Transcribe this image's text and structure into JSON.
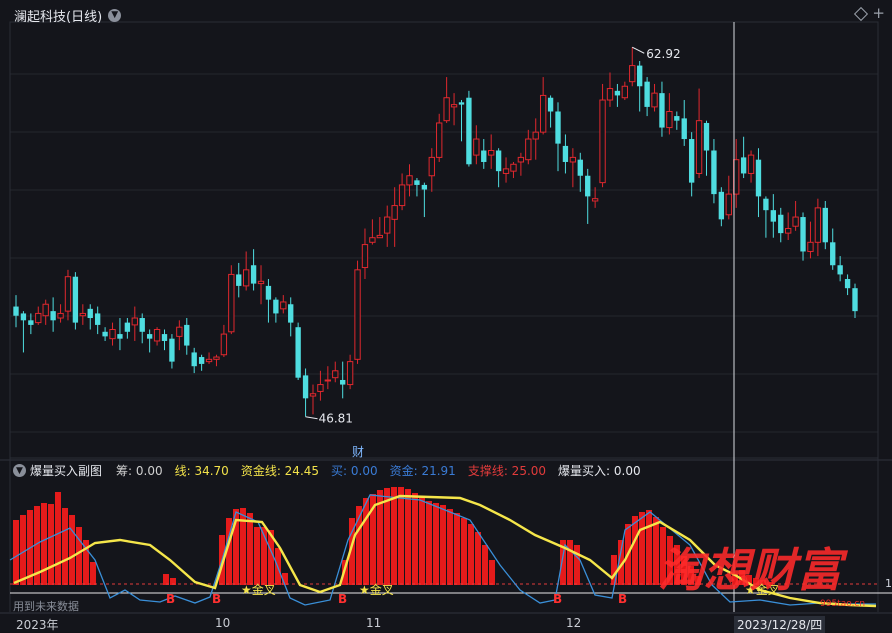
{
  "header": {
    "title": "澜起科技(日线)",
    "menu_icon": "chevron-down-icon",
    "right_icons": [
      "diamond-icon",
      "plus-icon"
    ]
  },
  "main_chart": {
    "labels": {
      "high": "62.92",
      "low": "46.81",
      "marker": "财"
    }
  },
  "sub_panel": {
    "title": "爆量买入副图",
    "indicators": [
      {
        "label": "筹",
        "value": "0.00",
        "color": "#d0d0d0"
      },
      {
        "label": "线",
        "value": "34.70",
        "color": "#f2e24a"
      },
      {
        "label": "资金线",
        "value": "24.45",
        "color": "#f2e24a"
      },
      {
        "label": "买",
        "value": "0.00",
        "color": "#3a7bd5"
      },
      {
        "label": "资金",
        "value": "21.91",
        "color": "#3a7bd5"
      },
      {
        "label": "支撑线",
        "value": "25.00",
        "color": "#e23b3b"
      },
      {
        "label": "爆量买入",
        "value": "0.00",
        "color": "#e6e8ee"
      }
    ],
    "signals": {
      "buy": "B",
      "golden_cross": "金叉"
    },
    "footer_note": "用到未来数据",
    "axis_right": "1"
  },
  "x_axis": {
    "labels": [
      "2023年",
      "10",
      "11",
      "12",
      "2023/12/28/四"
    ]
  },
  "watermark": {
    "text": "淘想财富",
    "site": "995tao.cn"
  },
  "colors": {
    "up": "#e0282e",
    "down": "#4fdde0",
    "line_yellow": "#f5e64a",
    "line_blue": "#3a8fd8",
    "support": "#e23b3b",
    "bg": "#14151b"
  },
  "chart_data": {
    "type": "candlestick",
    "ylim": [
      45,
      64
    ],
    "candles": [
      [
        51.2,
        51.6,
        52.1,
        50.7,
        0
      ],
      [
        51.3,
        51.0,
        51.4,
        49.6,
        0
      ],
      [
        51.0,
        50.8,
        51.3,
        50.4,
        0
      ],
      [
        50.9,
        51.3,
        51.6,
        50.8,
        1
      ],
      [
        51.2,
        51.7,
        51.9,
        50.8,
        1
      ],
      [
        51.4,
        51.0,
        52.0,
        50.5,
        0
      ],
      [
        51.1,
        51.3,
        51.7,
        50.9,
        1
      ],
      [
        51.4,
        52.9,
        53.2,
        51.0,
        1
      ],
      [
        52.9,
        50.9,
        53.1,
        50.6,
        0
      ],
      [
        51.2,
        51.3,
        51.7,
        50.8,
        1
      ],
      [
        51.5,
        51.1,
        51.7,
        50.6,
        0
      ],
      [
        51.3,
        50.8,
        51.6,
        50.4,
        0
      ],
      [
        50.5,
        50.3,
        50.7,
        50.1,
        0
      ],
      [
        50.2,
        50.6,
        50.9,
        49.9,
        1
      ],
      [
        50.4,
        50.2,
        51.1,
        49.7,
        0
      ],
      [
        50.9,
        50.5,
        51.1,
        50.2,
        0
      ],
      [
        50.8,
        51.1,
        51.6,
        50.1,
        1
      ],
      [
        51.1,
        50.5,
        51.3,
        50.0,
        0
      ],
      [
        50.4,
        50.2,
        50.6,
        49.6,
        0
      ],
      [
        50.1,
        50.6,
        50.7,
        49.9,
        1
      ],
      [
        50.4,
        50.1,
        50.6,
        49.7,
        0
      ],
      [
        50.2,
        49.2,
        50.4,
        48.9,
        0
      ],
      [
        50.3,
        50.7,
        51.0,
        49.7,
        1
      ],
      [
        50.8,
        49.9,
        51.1,
        49.5,
        0
      ],
      [
        49.6,
        49.0,
        49.8,
        48.7,
        0
      ],
      [
        49.4,
        49.1,
        49.5,
        48.8,
        0
      ],
      [
        49.2,
        49.3,
        49.6,
        49.1,
        1
      ],
      [
        49.3,
        49.4,
        49.5,
        49.0,
        1
      ],
      [
        49.5,
        50.4,
        50.8,
        49.4,
        1
      ],
      [
        50.5,
        53.0,
        53.4,
        50.4,
        1
      ],
      [
        53.0,
        52.5,
        53.5,
        52.0,
        0
      ],
      [
        52.5,
        53.2,
        54.0,
        52.3,
        1
      ],
      [
        53.4,
        52.6,
        54.1,
        52.3,
        0
      ],
      [
        52.6,
        52.7,
        53.4,
        51.7,
        1
      ],
      [
        52.5,
        51.9,
        52.8,
        50.9,
        0
      ],
      [
        51.9,
        51.3,
        52.0,
        50.9,
        0
      ],
      [
        51.5,
        51.8,
        52.1,
        51.3,
        1
      ],
      [
        51.7,
        50.9,
        52.0,
        50.3,
        0
      ],
      [
        50.7,
        48.5,
        50.9,
        48.4,
        0
      ],
      [
        48.6,
        47.6,
        48.9,
        46.8,
        0
      ],
      [
        47.7,
        47.8,
        48.2,
        46.9,
        1
      ],
      [
        47.9,
        48.2,
        48.8,
        47.5,
        1
      ],
      [
        48.4,
        48.4,
        49.0,
        48.0,
        1
      ],
      [
        48.5,
        48.8,
        49.2,
        48.3,
        1
      ],
      [
        48.4,
        48.2,
        49.2,
        47.6,
        0
      ],
      [
        48.2,
        49.2,
        49.5,
        48.0,
        1
      ],
      [
        49.3,
        53.2,
        53.6,
        49.1,
        1
      ],
      [
        53.3,
        54.3,
        55.0,
        52.8,
        1
      ],
      [
        54.4,
        54.6,
        55.4,
        54.3,
        1
      ],
      [
        54.6,
        54.7,
        55.5,
        54.6,
        1
      ],
      [
        54.8,
        55.5,
        56.0,
        54.2,
        1
      ],
      [
        55.4,
        56.0,
        56.8,
        54.2,
        1
      ],
      [
        56.0,
        56.9,
        57.4,
        55.8,
        1
      ],
      [
        56.9,
        57.3,
        57.8,
        56.4,
        1
      ],
      [
        57.1,
        56.9,
        57.2,
        56.4,
        0
      ],
      [
        56.9,
        56.7,
        57.0,
        55.5,
        0
      ],
      [
        57.3,
        58.1,
        58.5,
        56.6,
        1
      ],
      [
        58.1,
        59.6,
        60.0,
        57.9,
        1
      ],
      [
        59.7,
        60.7,
        61.6,
        59.6,
        1
      ],
      [
        60.4,
        60.3,
        60.9,
        59.5,
        1
      ],
      [
        60.5,
        60.4,
        60.6,
        58.8,
        0
      ],
      [
        60.7,
        57.8,
        61.0,
        57.7,
        0
      ],
      [
        58.2,
        58.9,
        59.5,
        57.8,
        1
      ],
      [
        58.4,
        57.9,
        58.9,
        57.6,
        0
      ],
      [
        58.2,
        58.4,
        59.1,
        57.6,
        1
      ],
      [
        58.4,
        57.5,
        58.5,
        56.8,
        0
      ],
      [
        57.4,
        57.6,
        58.1,
        57.0,
        1
      ],
      [
        57.5,
        57.8,
        57.9,
        57.2,
        1
      ],
      [
        57.9,
        58.1,
        58.3,
        57.3,
        1
      ],
      [
        58.0,
        58.9,
        59.3,
        57.8,
        1
      ],
      [
        58.9,
        59.2,
        59.8,
        58.0,
        1
      ],
      [
        59.2,
        60.8,
        61.6,
        59.1,
        1
      ],
      [
        60.7,
        60.1,
        60.8,
        59.4,
        0
      ],
      [
        60.1,
        58.7,
        60.5,
        57.5,
        0
      ],
      [
        58.6,
        57.9,
        59.1,
        57.4,
        0
      ],
      [
        57.9,
        58.1,
        58.5,
        56.8,
        1
      ],
      [
        58.0,
        57.3,
        58.3,
        56.6,
        0
      ],
      [
        57.3,
        56.4,
        57.6,
        55.2,
        0
      ],
      [
        56.3,
        56.2,
        56.8,
        55.9,
        1
      ],
      [
        57.0,
        60.6,
        61.3,
        56.8,
        1
      ],
      [
        60.6,
        61.1,
        61.8,
        60.3,
        1
      ],
      [
        61.0,
        60.8,
        61.3,
        60.3,
        0
      ],
      [
        60.7,
        61.2,
        61.4,
        60.6,
        1
      ],
      [
        61.4,
        62.1,
        62.9,
        61.2,
        1
      ],
      [
        62.1,
        61.2,
        62.3,
        60.1,
        0
      ],
      [
        61.4,
        60.3,
        61.6,
        59.9,
        0
      ],
      [
        60.3,
        60.9,
        61.3,
        60.1,
        1
      ],
      [
        60.9,
        59.4,
        61.4,
        59.0,
        0
      ],
      [
        59.4,
        60.1,
        60.9,
        59.1,
        1
      ],
      [
        59.9,
        59.7,
        60.1,
        59.3,
        0
      ],
      [
        59.8,
        58.9,
        60.6,
        58.6,
        0
      ],
      [
        58.9,
        57.0,
        59.2,
        56.4,
        0
      ],
      [
        57.4,
        59.7,
        61.1,
        57.2,
        1
      ],
      [
        59.6,
        58.4,
        59.7,
        57.3,
        0
      ],
      [
        58.4,
        56.5,
        58.9,
        56.1,
        0
      ],
      [
        56.6,
        55.4,
        56.8,
        55.1,
        0
      ],
      [
        55.6,
        56.5,
        57.3,
        55.4,
        1
      ],
      [
        56.5,
        58.0,
        58.9,
        55.9,
        1
      ],
      [
        58.1,
        57.4,
        59.0,
        57.2,
        0
      ],
      [
        57.4,
        58.2,
        58.4,
        57.0,
        1
      ],
      [
        58.0,
        56.4,
        58.5,
        55.5,
        0
      ],
      [
        56.3,
        55.8,
        56.4,
        54.6,
        0
      ],
      [
        55.8,
        55.3,
        56.5,
        54.6,
        0
      ],
      [
        55.6,
        54.8,
        55.9,
        54.4,
        0
      ],
      [
        54.8,
        55.0,
        55.7,
        54.5,
        1
      ],
      [
        55.1,
        55.5,
        56.2,
        54.9,
        1
      ],
      [
        55.5,
        54.0,
        55.7,
        53.6,
        0
      ],
      [
        54.0,
        54.4,
        55.3,
        53.7,
        1
      ],
      [
        54.4,
        55.9,
        56.3,
        53.8,
        1
      ],
      [
        55.9,
        54.4,
        56.2,
        54.1,
        0
      ],
      [
        54.4,
        53.4,
        55.0,
        53.2,
        0
      ],
      [
        53.4,
        53.0,
        53.8,
        52.7,
        0
      ],
      [
        52.8,
        52.4,
        53.0,
        52.1,
        0
      ],
      [
        52.4,
        51.4,
        52.6,
        51.1,
        0
      ]
    ]
  }
}
